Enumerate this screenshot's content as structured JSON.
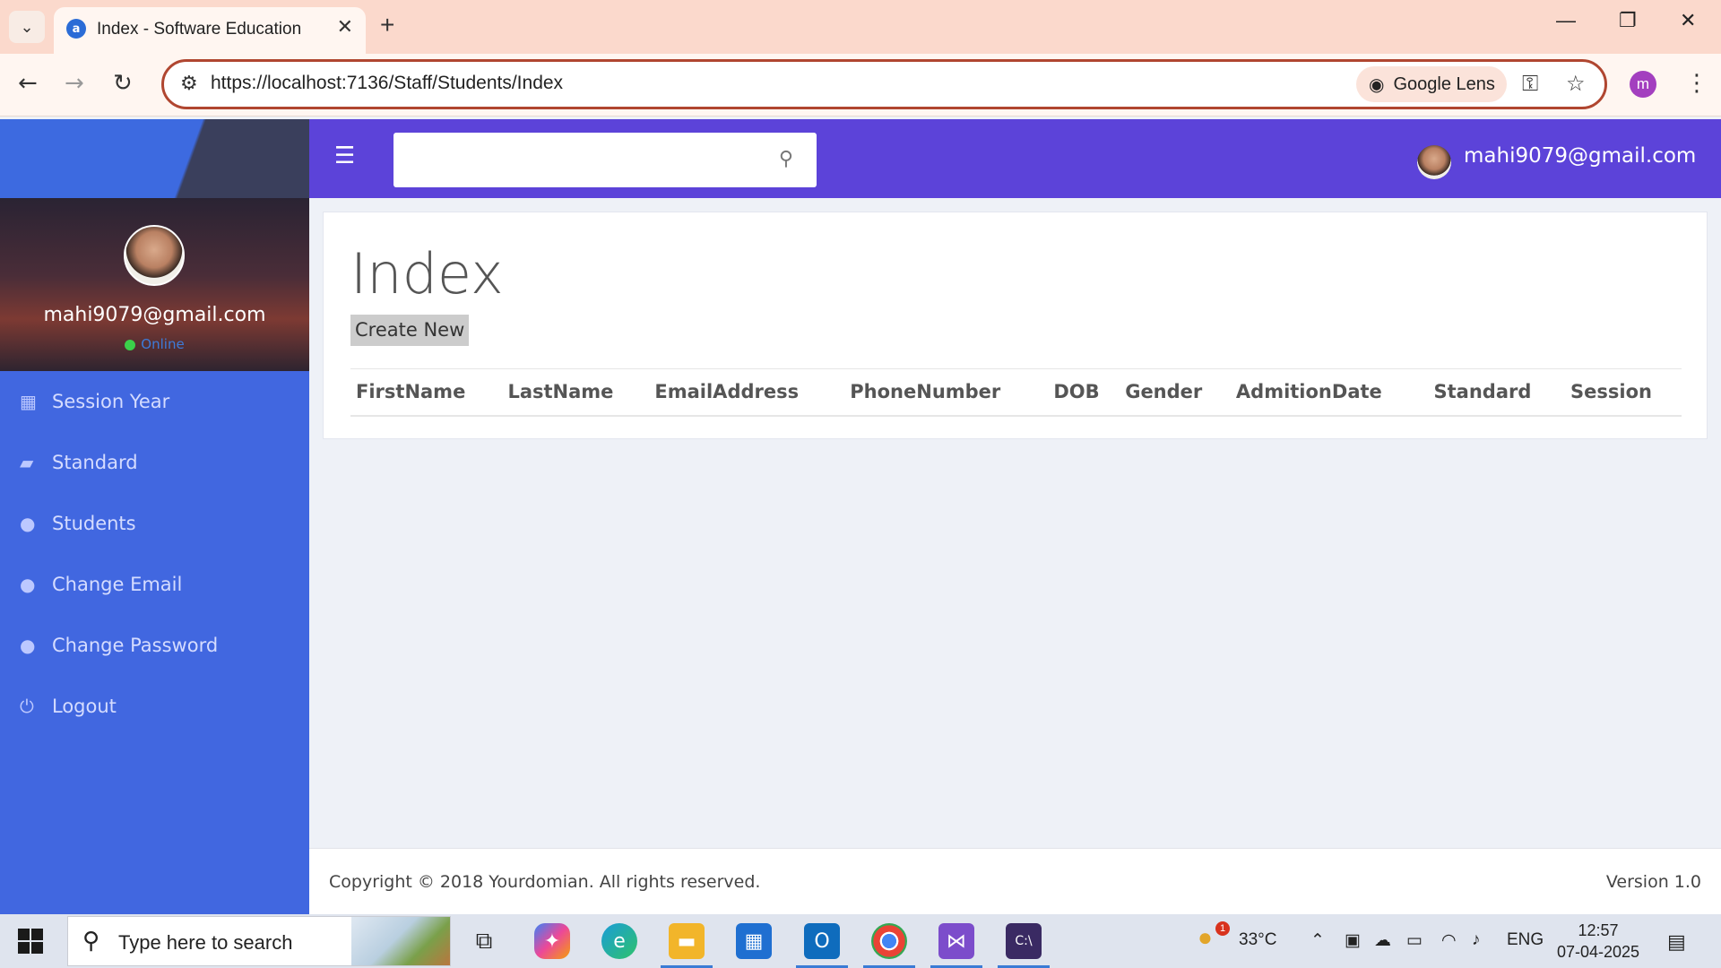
{
  "browser": {
    "tab_title": "Index - Software Education",
    "url_host": "https://localhost",
    "url_rest": ":7136/Staff/Students/Index",
    "lens_label": "Google Lens",
    "profile_initial": "m"
  },
  "app": {
    "user_email": "mahi9079@gmail.com",
    "user_status": "Online",
    "menu": [
      {
        "label": "Session Year",
        "icon": "calendar-icon"
      },
      {
        "label": "Standard",
        "icon": "book-icon"
      },
      {
        "label": "Students",
        "icon": "user-icon"
      },
      {
        "label": "Change Email",
        "icon": "user-icon"
      },
      {
        "label": "Change Password",
        "icon": "user-icon"
      },
      {
        "label": "Logout",
        "icon": "power-icon"
      }
    ],
    "search_placeholder": "",
    "page_title": "Index",
    "create_new_label": "Create New",
    "table_headers": [
      "FirstName",
      "LastName",
      "EmailAddress",
      "PhoneNumber",
      "DOB",
      "Gender",
      "AdmitionDate",
      "Standard",
      "Session"
    ],
    "footer_copyright": "Copyright © 2018 Yourdomian. All rights reserved.",
    "footer_version": "Version 1.0"
  },
  "taskbar": {
    "search_placeholder": "Type here to search",
    "weather_temp": "33°C",
    "weather_badge": "1",
    "language": "ENG",
    "time": "12:57",
    "date": "07-04-2025"
  },
  "colors": {
    "sidebar": "#4167e0",
    "topbar": "#5c43d9",
    "omnibox_border": "#b04630",
    "tabbar": "#fbd9cc"
  }
}
